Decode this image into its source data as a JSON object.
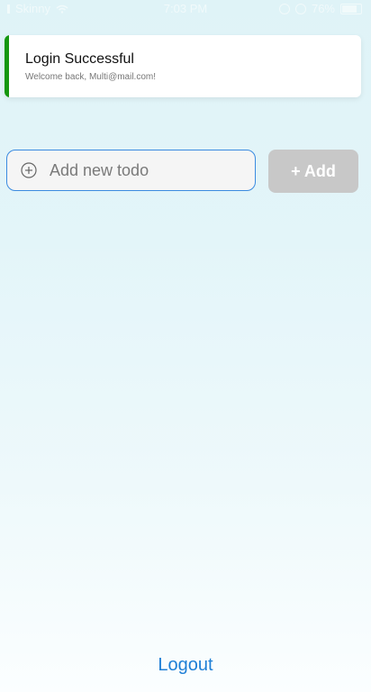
{
  "status_bar": {
    "carrier": "Skinny",
    "time": "7:03 PM",
    "battery": "76%"
  },
  "toast": {
    "title": "Login Successful",
    "message": "Welcome back, Multi@mail.com!",
    "accent_color": "#15970f"
  },
  "todo_form": {
    "placeholder": "Add new todo",
    "value": "",
    "add_label": "+ Add"
  },
  "footer": {
    "logout_label": "Logout"
  },
  "icons": {
    "add_circle": "add-circle-icon"
  },
  "colors": {
    "link_blue": "#1e7fd6",
    "input_border": "#3b8be0",
    "button_disabled": "#c8c8c8"
  }
}
